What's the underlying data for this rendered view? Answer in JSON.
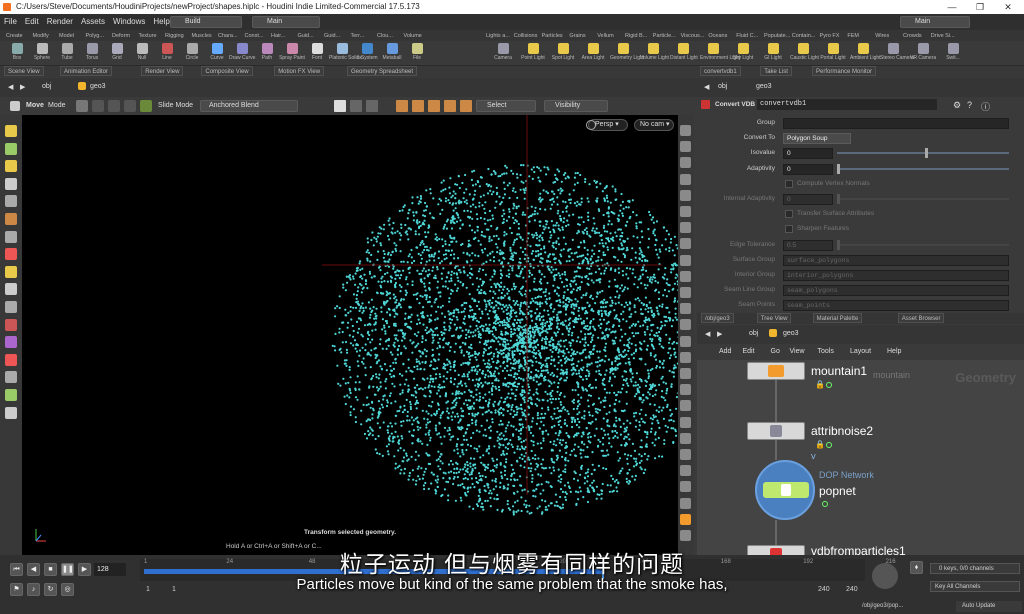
{
  "window": {
    "title": "C:/Users/Steve/Documents/HoudiniProjects/newProject/shapes.hiplc - Houdini Indie Limited-Commercial 17.5.173",
    "minimize": "—",
    "restore": "❐",
    "close": "✕"
  },
  "menu": [
    "File",
    "Edit",
    "Render",
    "Assets",
    "Windows",
    "Help"
  ],
  "desktop": {
    "build": "Build",
    "main_left": "Main",
    "main_right": "Main"
  },
  "shelf_tabs_left": [
    "Create",
    "Modify",
    "Model",
    "Polyg...",
    "Deform",
    "Texture",
    "Rigging",
    "Muscles",
    "Chara...",
    "Const...",
    "Hair...",
    "Guid...",
    "Guid...",
    "Terr...",
    "Clou...",
    "Volume"
  ],
  "shelf_tabs_right": [
    "Lights a...",
    "Collisions",
    "Particles",
    "Grains",
    "Vellum",
    "Rigid B...",
    "Particle...",
    "Viscous...",
    "Oceans",
    "Fluid C...",
    "Populate...",
    "Contain...",
    "Pyro FX",
    "FEM",
    "Wires",
    "Crowds",
    "Drive Si..."
  ],
  "tools_left": [
    "Box",
    "Sphere",
    "Tube",
    "Torus",
    "Grid",
    "Null",
    "Line",
    "Circle",
    "Curve",
    "Draw Curve",
    "Path",
    "Spray Paint",
    "Font",
    "Platonic Solids",
    "L-System",
    "Metaball",
    "File"
  ],
  "tools_right": [
    "Camera",
    "Point Light",
    "Spot Light",
    "Area Light",
    "Geometry Light",
    "Volume Light",
    "Distant Light",
    "Environment Light",
    "Sky Light",
    "GI Light",
    "Caustic Light",
    "Portal Light",
    "Ambient Light",
    "Stereo Camera",
    "VR Camera",
    "Swit..."
  ],
  "pane_tabs_left": [
    "Scene View",
    "Animation Editor",
    "Render View",
    "Composite View",
    "Motion FX View",
    "Geometry Spreadsheet"
  ],
  "pane_tabs_right": [
    "convertvdb1",
    "Take List",
    "Performance Monitor"
  ],
  "path": {
    "obj": "obj",
    "geo": "geo3"
  },
  "viewport_toolbar": {
    "tool": "Move",
    "mode": "Mode",
    "slide": "Slide Mode",
    "blend": "Anchored Blend",
    "select": "Select",
    "visibility": "Visibility",
    "persp": "Persp ▾",
    "cam": "No cam ▾"
  },
  "viewport_status": {
    "line1": "Transform selected geometry.",
    "line2": "Hold A or Ctrl+A or Shift+A or C..."
  },
  "params": {
    "node_type": "Convert VDB",
    "node_name": "convertvdb1",
    "rows": [
      {
        "label": "Group",
        "value": "",
        "kind": "field"
      },
      {
        "label": "Convert To",
        "value": "Polygon Soup",
        "kind": "menu"
      },
      {
        "label": "Isovalue",
        "value": "0",
        "kind": "slider"
      },
      {
        "label": "Adaptivity",
        "value": "0",
        "kind": "slider"
      },
      {
        "label": "",
        "value": "Compute Vertex Normals",
        "kind": "check"
      },
      {
        "label": "Internal Adaptivity",
        "value": "0",
        "kind": "slider_dis"
      },
      {
        "label": "",
        "value": "Transfer Surface Attributes",
        "kind": "check"
      },
      {
        "label": "",
        "value": "Sharpen Features",
        "kind": "check"
      },
      {
        "label": "Edge Tolerance",
        "value": "0.5",
        "kind": "slider_dis"
      },
      {
        "label": "Surface Group",
        "value": "surface_polygons",
        "kind": "field_dis"
      },
      {
        "label": "Interior Group",
        "value": "interior_polygons",
        "kind": "field_dis"
      },
      {
        "label": "Seam Line Group",
        "value": "seam_polygons",
        "kind": "field_dis"
      },
      {
        "label": "Seam Points",
        "value": "seam_points",
        "kind": "field_dis"
      }
    ]
  },
  "net_tabs": [
    "/obj/geo3",
    "Tree View",
    "Material Palette",
    "Asset Browser"
  ],
  "net_menu": [
    "Add",
    "Edit",
    "Go",
    "View",
    "Tools",
    "Layout",
    "Help"
  ],
  "net_context": "Geometry",
  "nodes": [
    {
      "name": "mountain1",
      "sub": "mountain"
    },
    {
      "name": "attribnoise2",
      "sub": ""
    },
    {
      "name": "popnet",
      "sub": "DOP Network"
    },
    {
      "name": "vdbfromparticles1",
      "sub": ""
    }
  ],
  "timeline": {
    "frame": "128",
    "start": "1",
    "start2": "1",
    "end": "240",
    "end2": "240",
    "ticks": [
      "1",
      "24",
      "48",
      "72",
      "96",
      "120",
      "144",
      "168",
      "192",
      "216"
    ],
    "keys": "0 keys, 0/0 channels",
    "channels": "Key All Channels",
    "path": "/obj/geo3/pop...",
    "update": "Auto Update"
  },
  "subtitles": {
    "zh": "粒子运动 但与烟雾有同样的问题",
    "en": "Particles move but kind of the same problem that the smoke has,"
  },
  "colors": {
    "particles": "#4fd6d6",
    "accent": "#f37021"
  }
}
